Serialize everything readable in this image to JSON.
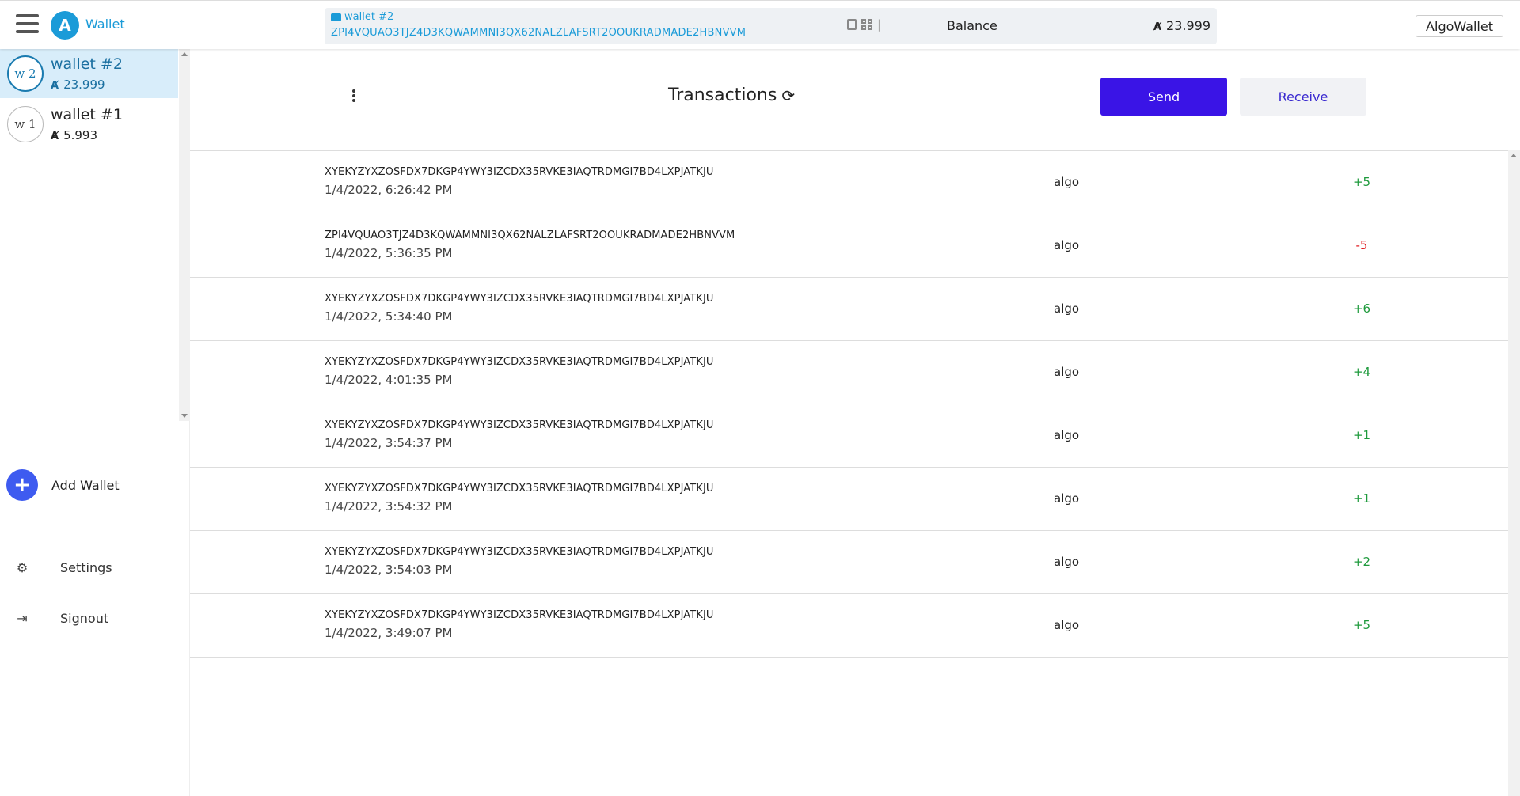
{
  "topbar": {
    "brand": "Wallet",
    "logo_glyph": "A",
    "address_box": {
      "wallet_name": "wallet #2",
      "address": "ZPI4VQUAO3TJZ4D3KQWAMMNI3QX62NALZLAFSRT2OOUKRADMADE2HBNVVM",
      "balance_label": "Balance",
      "balance_value": "23.999",
      "separator": "|"
    },
    "user_button": "AlgoWallet"
  },
  "algo_symbol": "Ⱥ",
  "sidebar": {
    "wallets": [
      {
        "avatar": "w 2",
        "name": "wallet #2",
        "balance": "23.999",
        "active": true
      },
      {
        "avatar": "w 1",
        "name": "wallet #1",
        "balance": "5.993",
        "active": false
      }
    ],
    "add_wallet": {
      "icon": "+",
      "label": "Add Wallet"
    },
    "settings": {
      "icon": "⚙",
      "label": "Settings"
    },
    "signout": {
      "icon": "⇥",
      "label": "Signout"
    }
  },
  "main": {
    "title": "Transactions",
    "refresh_icon": "⟳",
    "send_label": "Send",
    "receive_label": "Receive",
    "transactions": [
      {
        "address": "XYEKYZYXZOSFDX7DKGP4YWY3IZCDX35RVKE3IAQTRDMGI7BD4LXPJATKJU",
        "date": "1/4/2022, 6:26:42 PM",
        "asset": "algo",
        "amount": "+5"
      },
      {
        "address": "ZPI4VQUAO3TJZ4D3KQWAMMNI3QX62NALZLAFSRT2OOUKRADMADE2HBNVVM",
        "date": "1/4/2022, 5:36:35 PM",
        "asset": "algo",
        "amount": "-5"
      },
      {
        "address": "XYEKYZYXZOSFDX7DKGP4YWY3IZCDX35RVKE3IAQTRDMGI7BD4LXPJATKJU",
        "date": "1/4/2022, 5:34:40 PM",
        "asset": "algo",
        "amount": "+6"
      },
      {
        "address": "XYEKYZYXZOSFDX7DKGP4YWY3IZCDX35RVKE3IAQTRDMGI7BD4LXPJATKJU",
        "date": "1/4/2022, 4:01:35 PM",
        "asset": "algo",
        "amount": "+4"
      },
      {
        "address": "XYEKYZYXZOSFDX7DKGP4YWY3IZCDX35RVKE3IAQTRDMGI7BD4LXPJATKJU",
        "date": "1/4/2022, 3:54:37 PM",
        "asset": "algo",
        "amount": "+1"
      },
      {
        "address": "XYEKYZYXZOSFDX7DKGP4YWY3IZCDX35RVKE3IAQTRDMGI7BD4LXPJATKJU",
        "date": "1/4/2022, 3:54:32 PM",
        "asset": "algo",
        "amount": "+1"
      },
      {
        "address": "XYEKYZYXZOSFDX7DKGP4YWY3IZCDX35RVKE3IAQTRDMGI7BD4LXPJATKJU",
        "date": "1/4/2022, 3:54:03 PM",
        "asset": "algo",
        "amount": "+2"
      },
      {
        "address": "XYEKYZYXZOSFDX7DKGP4YWY3IZCDX35RVKE3IAQTRDMGI7BD4LXPJATKJU",
        "date": "1/4/2022, 3:49:07 PM",
        "asset": "algo",
        "amount": "+5"
      }
    ]
  },
  "colors": {
    "brand": "#1b9bd8",
    "send_button": "#3a14e6",
    "positive": "#1e9a3c",
    "negative": "#e0161b",
    "active_wallet_bg": "#d8edfa"
  }
}
